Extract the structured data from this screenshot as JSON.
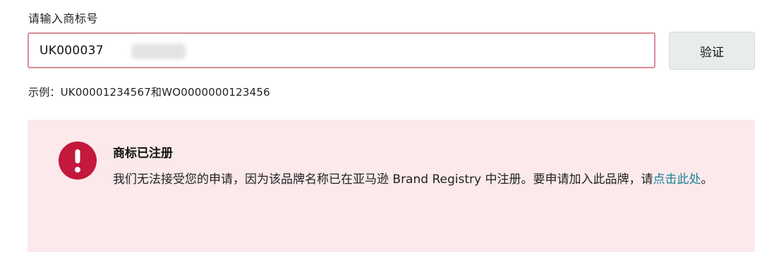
{
  "form": {
    "label": "请输入商标号",
    "input_value": "UK000037",
    "verify_label": "验证",
    "example": "示例：UK00001234567和WO0000000123456"
  },
  "alert": {
    "icon": "error-exclamation-icon",
    "icon_color": "#c4183c",
    "background": "#fbe9eb",
    "title": "商标已注册",
    "body_before_link": "我们无法接受您的申请，因为该品牌名称已在亚马逊 Brand Registry 中注册。要申请加入此品牌，请",
    "link_text": "点击此处",
    "body_after_link": "。"
  }
}
